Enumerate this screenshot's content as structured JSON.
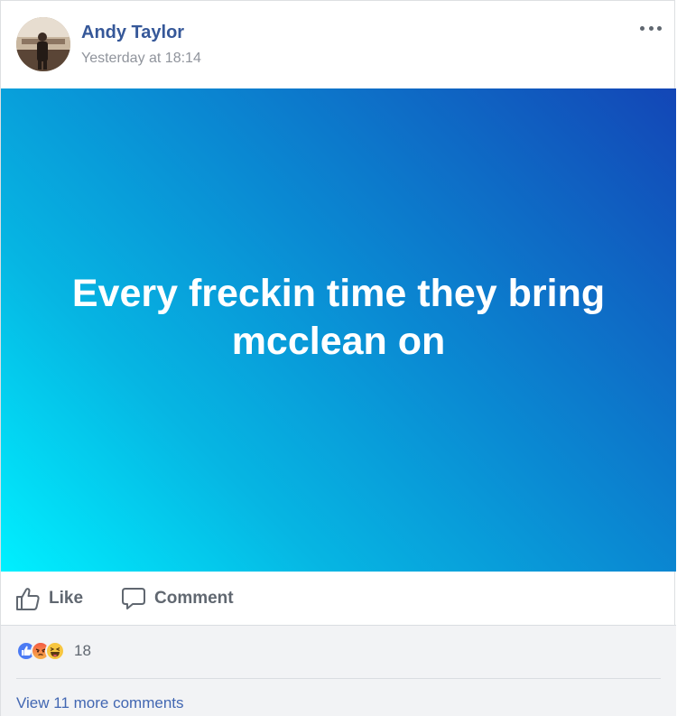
{
  "post": {
    "author": "Andy Taylor",
    "timestamp": "Yesterday at 18:14",
    "text": "Every freckin time they bring mcclean on",
    "background_gradient": [
      "#00f0ff",
      "#06b6e3",
      "#0a8bd3",
      "#1346b6"
    ]
  },
  "actions": {
    "like_label": "Like",
    "comment_label": "Comment"
  },
  "reactions": {
    "types": [
      "like-icon",
      "angry-icon",
      "haha-icon"
    ],
    "count": "18"
  },
  "comments": {
    "more_label": "View 11 more comments"
  },
  "colors": {
    "link": "#365899",
    "secondary_text": "#90949c",
    "action_text": "#606770",
    "footer_bg": "#f2f3f5"
  }
}
